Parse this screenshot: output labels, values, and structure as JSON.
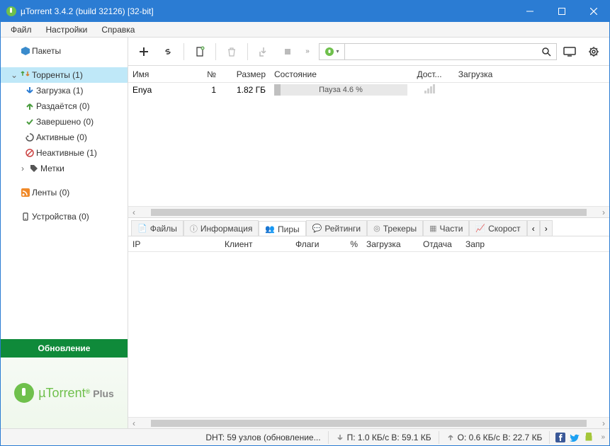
{
  "title": "µTorrent 3.4.2  (build 32126) [32-bit]",
  "menu": {
    "file": "Файл",
    "settings": "Настройки",
    "help": "Справка"
  },
  "sidebar": {
    "packages": "Пакеты",
    "torrents": "Торренты (1)",
    "items": [
      {
        "label": "Загрузка (1)"
      },
      {
        "label": "Раздаётся (0)"
      },
      {
        "label": "Завершено (0)"
      },
      {
        "label": "Активные (0)"
      },
      {
        "label": "Неактивные (1)"
      }
    ],
    "labels": "Метки",
    "feeds": "Ленты (0)",
    "devices": "Устройства (0)",
    "update": "Обновление",
    "plus_main": "µTorrent",
    "plus_sub": "Plus"
  },
  "search": {
    "placeholder": ""
  },
  "table": {
    "headers": {
      "name": "Имя",
      "num": "№",
      "size": "Размер",
      "state": "Состояние",
      "avail": "Дост...",
      "download": "Загрузка"
    },
    "rows": [
      {
        "name": "Enya",
        "num": "1",
        "size": "1.82 ГБ",
        "state": "Пауза 4.6 %"
      }
    ]
  },
  "details": {
    "tabs": {
      "files": "Файлы",
      "info": "Информация",
      "peers": "Пиры",
      "ratings": "Рейтинги",
      "trackers": "Трекеры",
      "pieces": "Части",
      "speed": "Скорост"
    },
    "headers": {
      "ip": "IP",
      "client": "Клиент",
      "flags": "Флаги",
      "pct": "%",
      "download": "Загрузка",
      "upload": "Отдача",
      "req": "Запр"
    }
  },
  "status": {
    "dht": "DHT: 59 узлов  (обновление...",
    "down": "П: 1.0 КБ/с В: 59.1 КБ",
    "up": "О: 0.6 КБ/с В: 22.7 КБ"
  }
}
